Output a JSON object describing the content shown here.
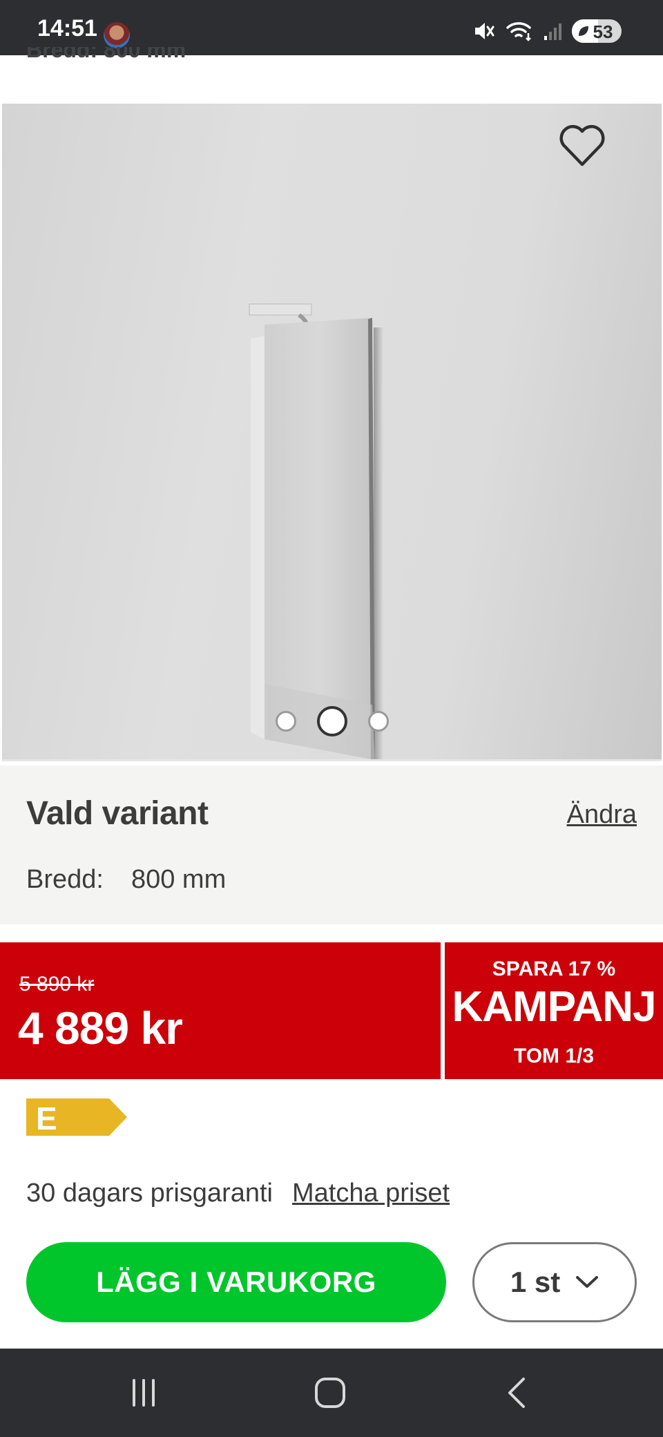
{
  "status_bar": {
    "time": "14:51",
    "battery_level": "53",
    "icons": [
      "mute-icon",
      "wifi-icon",
      "signal-icon",
      "battery-saver-icon"
    ]
  },
  "header": {
    "cropped_text": "Bredd: 800 mm"
  },
  "gallery": {
    "image_count": 3,
    "active_index": 1,
    "favorite_icon": "heart-outline-icon"
  },
  "variant": {
    "title": "Vald variant",
    "change_label": "Ändra",
    "attribute_label": "Bredd:",
    "attribute_value": "800 mm"
  },
  "price": {
    "old_price": "5 890 kr",
    "new_price": "4 889 kr",
    "save_label": "SPARA 17 %",
    "campaign_label": "KAMPANJ",
    "valid_until": "TOM 1/3"
  },
  "energy_label": {
    "class": "E",
    "color": "#e8b624"
  },
  "guarantee": {
    "text": "30 dagars prisgaranti",
    "link": "Matcha priset"
  },
  "cart": {
    "add_label": "LÄGG I VARUKORG",
    "quantity_label": "1 st"
  },
  "colors": {
    "accent_green": "#00c62b",
    "sale_red": "#cc0008",
    "system_bar": "#2d2e32"
  }
}
